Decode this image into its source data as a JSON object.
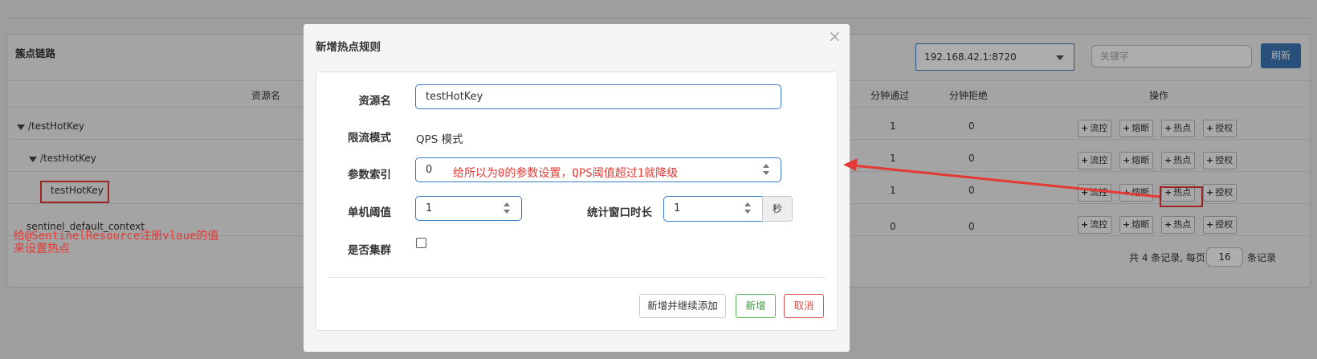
{
  "panel": {
    "title": "簇点链路",
    "ip_select_value": "192.168.42.1:8720",
    "keyword_placeholder": "关键字",
    "refresh_label": "刷新"
  },
  "table": {
    "headers": {
      "resource": "资源名",
      "pass_min": "分钟通过",
      "block_min": "分钟拒绝",
      "ops": "操作"
    },
    "rows": [
      {
        "name": "/testHotKey",
        "pass": "1",
        "block": "0"
      },
      {
        "name": "/testHotKey",
        "pass": "1",
        "block": "0"
      },
      {
        "name": "testHotKey",
        "pass": "1",
        "block": "0"
      },
      {
        "name": "sentinel_default_context",
        "pass": "0",
        "block": "0"
      }
    ],
    "op_labels": {
      "flow": "流控",
      "degrade": "熔断",
      "hot": "热点",
      "auth": "授权"
    },
    "op_icon": "+"
  },
  "pager": {
    "prefix": "共 4 条记录, 每页",
    "page_size": "16",
    "suffix": "条记录"
  },
  "annotations": {
    "left_line1": "给@SentinelResource注册vlaue的值",
    "left_line2": "来设置热点",
    "param_note": "给所以为0的参数设置，QPS阈值超过1就降级",
    "color": "#e53935"
  },
  "modal": {
    "title": "新增热点规则",
    "close_icon": "×",
    "labels": {
      "resource": "资源名",
      "mode": "限流模式",
      "param_index": "参数索引",
      "threshold": "单机阈值",
      "window": "统计窗口时长",
      "cluster": "是否集群"
    },
    "resource_value": "testHotKey",
    "mode_value": "QPS 模式",
    "param_index_value": "0",
    "threshold_value": "1",
    "window_value": "1",
    "window_unit": "秒",
    "cluster_checked": false,
    "buttons": {
      "add_continue": "新增并继续添加",
      "add": "新增",
      "cancel": "取消"
    }
  }
}
